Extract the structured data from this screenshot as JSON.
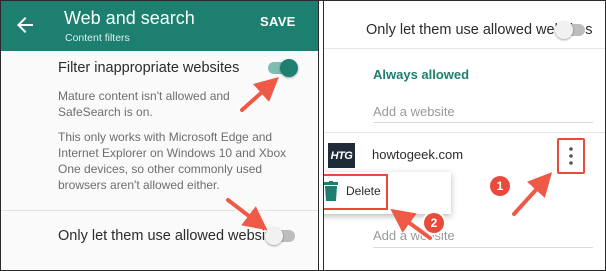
{
  "left_panel": {
    "appbar": {
      "title": "Web and search",
      "subtitle": "Content filters",
      "save_label": "SAVE",
      "back_icon": "arrow-back-icon"
    },
    "filter_toggle": {
      "label": "Filter inappropriate websites",
      "state": "on"
    },
    "filter_note": "Mature content isn't allowed and SafeSearch is on.",
    "info_text": "This only works with Microsoft Edge and Internet Explorer on Windows 10 and Xbox One devices, so other commonly used browsers aren't allowed either.",
    "allowed_only_toggle": {
      "label": "Only let them use allowed websites",
      "state": "off"
    }
  },
  "right_panel": {
    "allowed_only_toggle": {
      "label": "Only let them use allowed websites",
      "state": "off"
    },
    "section_heading": "Always allowed",
    "add_placeholder": "Add a website",
    "site": {
      "logo_text": "HTG",
      "name": "howtogeek.com",
      "more_icon": "more-vert-icon"
    },
    "context_menu": {
      "delete_label": "Delete",
      "delete_icon": "trash-icon"
    },
    "add_placeholder_2": "Add a website"
  },
  "annotations": {
    "step1": "1",
    "step2": "2"
  },
  "colors": {
    "appbar": "#1c7f6f",
    "accent": "#1c7f6f",
    "highlight": "#e84b3c",
    "toggle_on_track": "#7fbcb1",
    "toggle_off_track": "#bdbdbd"
  }
}
